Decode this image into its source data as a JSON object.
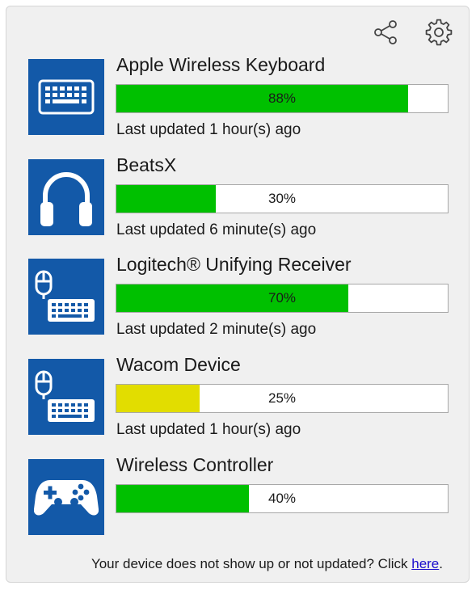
{
  "toolbar": {
    "share_icon": "share-icon",
    "settings_icon": "gear-icon"
  },
  "colors": {
    "icon_background": "#1359a8",
    "battery_good": "#00c000",
    "battery_low": "#e2dd00",
    "link": "#1a0dcc"
  },
  "devices": [
    {
      "name": "Apple Wireless Keyboard",
      "icon": "keyboard-icon",
      "battery_percent": 88,
      "battery_label": "88%",
      "battery_color": "#00c000",
      "last_updated": "Last updated 1 hour(s) ago"
    },
    {
      "name": "BeatsX",
      "icon": "headphones-icon",
      "battery_percent": 30,
      "battery_label": "30%",
      "battery_color": "#00c000",
      "last_updated": "Last updated 6 minute(s) ago"
    },
    {
      "name": "Logitech® Unifying Receiver",
      "icon": "mouse-keyboard-icon",
      "battery_percent": 70,
      "battery_label": "70%",
      "battery_color": "#00c000",
      "last_updated": "Last updated 2 minute(s) ago"
    },
    {
      "name": "Wacom Device",
      "icon": "mouse-keyboard-icon",
      "battery_percent": 25,
      "battery_label": "25%",
      "battery_color": "#e2dd00",
      "last_updated": "Last updated 1 hour(s) ago"
    },
    {
      "name": "Wireless Controller",
      "icon": "gamepad-icon",
      "battery_percent": 40,
      "battery_label": "40%",
      "battery_color": "#00c000",
      "last_updated": ""
    }
  ],
  "footer": {
    "text": "Your device does not show up or not updated? Click ",
    "link_text": "here",
    "suffix": "."
  }
}
